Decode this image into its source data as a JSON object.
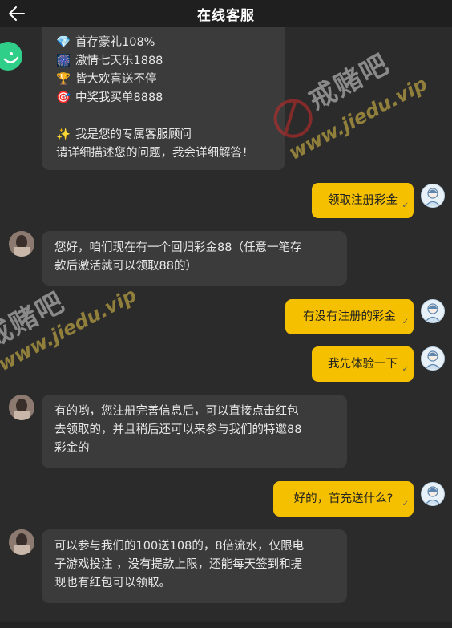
{
  "header": {
    "title": "在线客服"
  },
  "intro": {
    "lines": [
      {
        "icon": "💎",
        "icon_name": "gem-icon",
        "text": "首存豪礼108%"
      },
      {
        "icon": "🎆",
        "icon_name": "fireworks-icon",
        "text": "激情七天乐1888"
      },
      {
        "icon": "🏆",
        "icon_name": "trophy-icon",
        "text": "皆大欢喜送不停"
      },
      {
        "icon": "🎯",
        "icon_name": "target-icon",
        "text": "中奖我买单8888"
      }
    ],
    "advisor": {
      "icon": "✨",
      "icon_name": "sparkles-icon",
      "text": "我是您的专属客服顾问"
    },
    "prompt": "请详细描述您的问题，我会详细解答！"
  },
  "messages": {
    "m1": "领取注册彩金",
    "m2_line1": "您好，咱们现在有一个回归彩金88（任意一笔存",
    "m2_line2": "款后激活就可以领取88的）",
    "m3": "有没有注册的彩金",
    "m4": "我先体验一下",
    "m5_line1": "有的哟，您注册完善信息后，可以直接点击红包",
    "m5_line2": "去领取的，并且稍后还可以来参与我们的特邀88",
    "m5_line3": "彩金的",
    "m6": "好的，首充送什么?",
    "m7_line1": "可以参与我们的100送108的，8倍流水，仅限电",
    "m7_line2": "子游戏投注 ，没有提款上限，还能每天签到和提",
    "m7_line3": "现也有红包可以领取。"
  },
  "status": {
    "read_tick": "✓"
  },
  "watermark": {
    "cn": "戒赌吧",
    "url": "www.jiedu.vip"
  },
  "colors": {
    "user_bubble": "#f5c000",
    "agent_bubble": "#3b3b3b",
    "background": "#2b2b2b"
  }
}
